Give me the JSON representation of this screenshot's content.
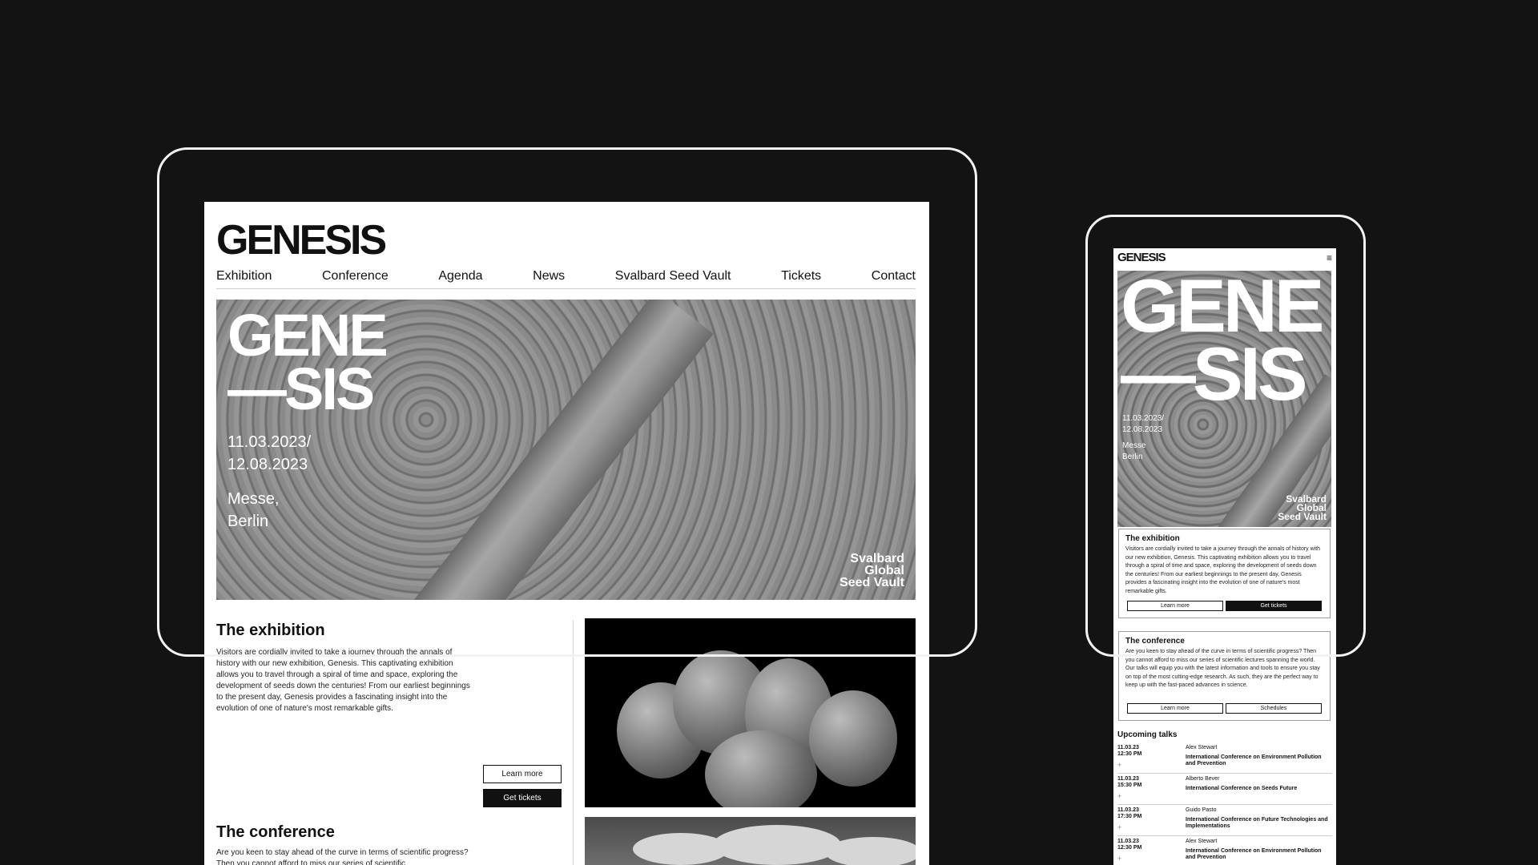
{
  "brand": "GENESIS",
  "nav": [
    "Exhibition",
    "Conference",
    "Agenda",
    "News",
    "Svalbard Seed Vault",
    "Tickets",
    "Contact"
  ],
  "hero": {
    "line1": "GENE",
    "line2": "—SIS",
    "date1": "11.03.2023/",
    "date2": "12.08.2023",
    "place1": "Messe,",
    "place2": "Berlin",
    "vault1": "Svalbard",
    "vault2": "Global",
    "vault3": "Seed Vault"
  },
  "phone_hero": {
    "date1": "11.03.2023/",
    "date2": "12.08.2023",
    "place1": "Messe",
    "place2": "Berlin"
  },
  "exhibition": {
    "title": "The exhibition",
    "body": "Visitors are cordially invited to take a journey through the annals of history with our new exhibition, Genesis. This captivating exhibition allows you to travel through a spiral of time and space, exploring the development of seeds down the centuries! From our earliest beginnings to the present day, Genesis provides a fascinating insight into the evolution of one of nature's most remarkable gifts.",
    "learn_more": "Learn more",
    "get_tickets": "Get tickets"
  },
  "conference": {
    "title": "The conference",
    "body_desktop": "Are you keen to stay ahead of the curve in terms of scientific progress? Then you cannot afford to miss our series of scientific",
    "body": "Are you keen to stay ahead of the curve in terms of scientific progress? Then you cannot afford to miss our series of scientific lectures spanning the world. Our talks will equip you with the latest information and tools to ensure you stay on top of the most cutting-edge research. As such, they are the perfect way to keep up with the fast-paced advances in science.",
    "learn_more": "Learn more",
    "schedules": "Schedules"
  },
  "talks": {
    "title": "Upcoming talks",
    "items": [
      {
        "date": "11.03.23",
        "time": "12:30 PM",
        "speaker": "Alex Stewart",
        "title": "International Conference on Environment Pollution and Prevention"
      },
      {
        "date": "11.03.23",
        "time": "15:30 PM",
        "speaker": "Alberto Bever",
        "title": "International Conference on Seeds Future"
      },
      {
        "date": "11.03.23",
        "time": "17:30 PM",
        "speaker": "Guido Pasto",
        "title": "International Conference on Future Technologies and Implementations"
      },
      {
        "date": "11.03.23",
        "time": "12:30 PM",
        "speaker": "Alex Stewart",
        "title": "International Conference on Environment Pollution and Prevention"
      }
    ]
  },
  "icons": {
    "menu": "hamburger-menu-icon",
    "plus": "plus-icon"
  }
}
